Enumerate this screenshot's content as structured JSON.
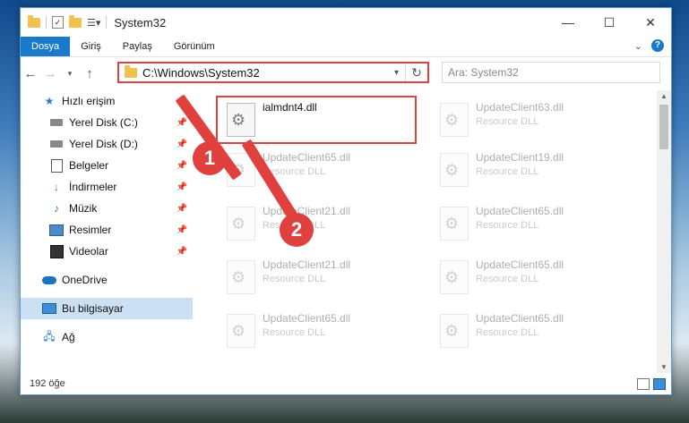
{
  "window": {
    "title": "System32"
  },
  "ribbon": {
    "tabs": [
      "Dosya",
      "Giriş",
      "Paylaş",
      "Görünüm"
    ],
    "help": "?"
  },
  "nav": {
    "address": "C:\\Windows\\System32",
    "search_placeholder": "Ara: System32"
  },
  "sidebar": {
    "items": [
      {
        "label": "Hızlı erişim",
        "icon": "star-icon"
      },
      {
        "label": "Yerel Disk (C:)",
        "icon": "drive-icon",
        "pinned": true
      },
      {
        "label": "Yerel Disk (D:)",
        "icon": "drive-icon",
        "pinned": true
      },
      {
        "label": "Belgeler",
        "icon": "documents-icon",
        "pinned": true
      },
      {
        "label": "İndirmeler",
        "icon": "download-icon",
        "pinned": true
      },
      {
        "label": "Müzik",
        "icon": "music-icon",
        "pinned": true
      },
      {
        "label": "Resimler",
        "icon": "pictures-icon",
        "pinned": true
      },
      {
        "label": "Videolar",
        "icon": "videos-icon",
        "pinned": true
      },
      {
        "label": "OneDrive",
        "icon": "cloud-icon"
      },
      {
        "label": "Bu bilgisayar",
        "icon": "pc-icon",
        "selected": true
      },
      {
        "label": "Ağ",
        "icon": "network-icon"
      }
    ]
  },
  "files": [
    {
      "name": "ialmdnt4.dll",
      "type": ""
    },
    {
      "name": "UpdateClient63.dll",
      "type": "Resource DLL"
    },
    {
      "name": "UpdateClient65.dll",
      "type": "Resource DLL"
    },
    {
      "name": "UpdateClient19.dll",
      "type": "Resource DLL"
    },
    {
      "name": "UpdateClient21.dll",
      "type": "Resource DLL"
    },
    {
      "name": "UpdateClient65.dll",
      "type": "Resource DLL"
    },
    {
      "name": "UpdateClient21.dll",
      "type": "Resource DLL"
    },
    {
      "name": "UpdateClient65.dll",
      "type": "Resource DLL"
    },
    {
      "name": "UpdateClient65.dll",
      "type": "Resource DLL"
    },
    {
      "name": "UpdateClient65.dll",
      "type": "Resource DLL"
    }
  ],
  "status": {
    "count": "192 öğe"
  },
  "annotations": {
    "step1": "1",
    "step2": "2"
  },
  "colors": {
    "accent": "#1979ca",
    "highlight": "#e0413e"
  }
}
